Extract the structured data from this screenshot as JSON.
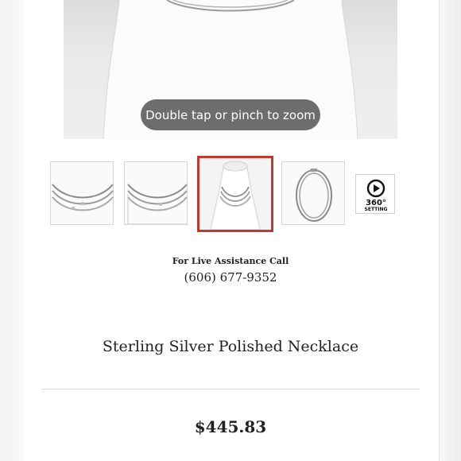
{
  "gallery": {
    "zoom_hint": "Double tap or pinch to zoom",
    "thumbnails": [
      {
        "label": "necklace-detail-view-1"
      },
      {
        "label": "necklace-measurement-view"
      },
      {
        "label": "necklace-on-bust-view",
        "selected": true
      },
      {
        "label": "necklace-full-length-view"
      }
    ],
    "spin_button": {
      "line1": "360°",
      "line2": "SETTING",
      "icon": "play-icon"
    }
  },
  "assistance": {
    "label": "For Live Assistance Call",
    "phone": "(606) 677-9352"
  },
  "product": {
    "title": "Sterling Silver Polished Necklace",
    "price": "$445.83"
  },
  "colors": {
    "selected_border": "#c0392b",
    "text": "#222222",
    "hint_bg": "#6d6d6d"
  }
}
